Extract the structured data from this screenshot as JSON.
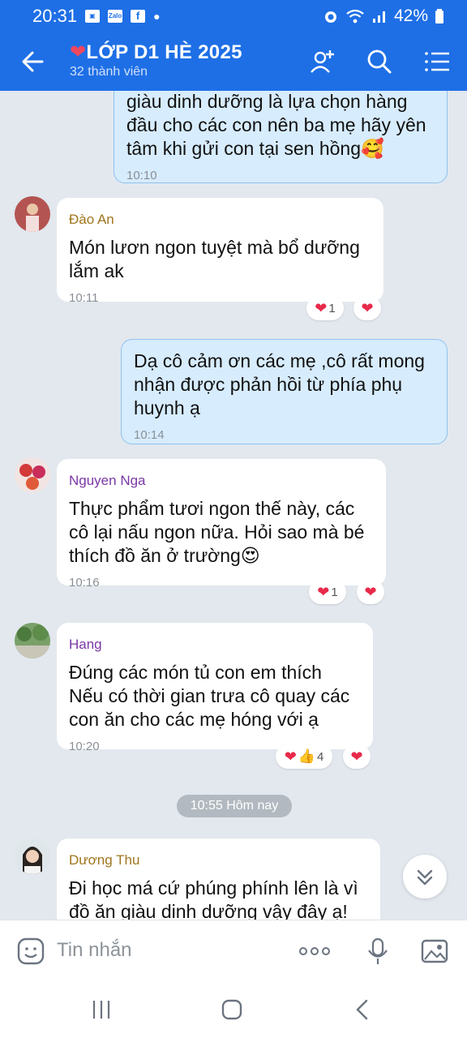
{
  "status": {
    "time": "20:31",
    "battery": "42%",
    "app_badge": "Zalo"
  },
  "header": {
    "title": "LỚP D1 HÈ 2025",
    "subtitle": "32 thành viên"
  },
  "messages": [
    {
      "sender": "",
      "text_lines": [
        "giàu dinh dưỡng là lựa chọn hàng",
        "đầu cho các con nên ba mẹ hãy yên",
        "tâm khi gửi con tại sen hồng🥰"
      ],
      "time": "10:10",
      "outgoing": true
    },
    {
      "sender": "Đào An",
      "text_lines": [
        "Món lươn ngon tuyệt mà bổ dưỡng",
        "lắm ak"
      ],
      "time": "10:11",
      "outgoing": false,
      "reaction_count": "1"
    },
    {
      "sender": "",
      "text_lines": [
        "Dạ cô cảm ơn các mẹ ,cô rất mong",
        "nhận được phản hồi từ phía phụ",
        "huynh ạ"
      ],
      "time": "10:14",
      "outgoing": true
    },
    {
      "sender": "Nguyen Nga",
      "text_lines": [
        "Thực phẩm tươi ngon thế này, các",
        "cô lại nấu ngon nữa. Hỏi sao mà bé",
        "thích đồ ăn ở trường😍"
      ],
      "time": "10:16",
      "outgoing": false,
      "reaction_count": "1"
    },
    {
      "sender": "Hang",
      "text_lines": [
        "Đúng các món tủ con em thích",
        "Nếu có thời gian trưa cô quay các",
        "con ăn cho các mẹ hóng với ạ"
      ],
      "time": "10:20",
      "outgoing": false,
      "reaction_count": "4"
    },
    {
      "sender": "Dương Thu",
      "text_lines": [
        "Đi học má cứ phúng phính lên là vì",
        "đồ ăn giàu dinh dưỡng vậy đây ạ!"
      ],
      "time": "",
      "outgoing": false
    }
  ],
  "date_divider": "10:55 Hôm nay",
  "composer": {
    "placeholder": "Tin nhắn"
  },
  "colors": {
    "header_blue": "#1e6fe6",
    "outgoing_bubble": "#d7ecfd",
    "chat_bg": "#e2e8ee",
    "heart_red": "#e8294a"
  }
}
